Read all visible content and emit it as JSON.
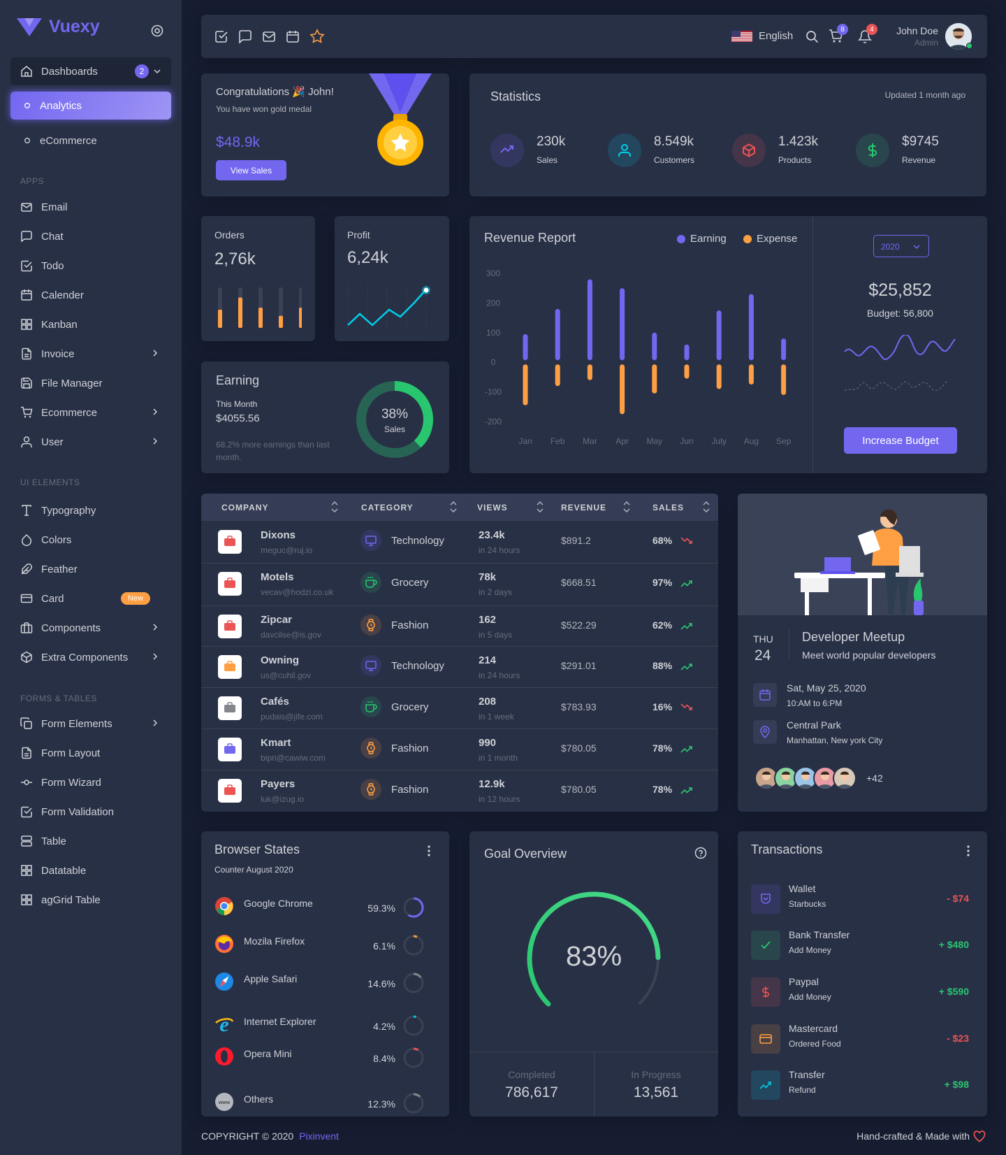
{
  "brand": {
    "name": "Vuexy"
  },
  "sidebar": {
    "dashboards": "Dashboards",
    "dashboards_badge": "2",
    "analytics": "Analytics",
    "ecommerce_dash": "eCommerce",
    "apps_head": "APPS",
    "apps": [
      "Email",
      "Chat",
      "Todo",
      "Calender",
      "Kanban",
      "Invoice",
      "File Manager",
      "Ecommerce",
      "User"
    ],
    "ui_head": "UI ELEMENTS",
    "ui": [
      "Typography",
      "Colors",
      "Feather",
      "Card",
      "Components",
      "Extra Components"
    ],
    "card_badge": "New",
    "forms_head": "FORMS & TABLES",
    "forms": [
      "Form Elements",
      "Form Layout",
      "Form Wizard",
      "Form Validation",
      "Table",
      "Datatable",
      "agGrid Table"
    ]
  },
  "navbar": {
    "language": "English",
    "cart_count": "8",
    "notif_count": "4",
    "user_name": "John Doe",
    "user_role": "Admin"
  },
  "congrats": {
    "title": "Congratulations 🎉 John!",
    "subtitle": "You have won gold medal",
    "amount": "$48.9k",
    "button": "View Sales"
  },
  "statistics": {
    "title": "Statistics",
    "updated": "Updated 1 month ago",
    "items": [
      {
        "value": "230k",
        "label": "Sales",
        "icon": "trending-up-icon",
        "color": "#7367f0"
      },
      {
        "value": "8.549k",
        "label": "Customers",
        "icon": "user-icon",
        "color": "#00cfe8"
      },
      {
        "value": "1.423k",
        "label": "Products",
        "icon": "box-icon",
        "color": "#ea5455"
      },
      {
        "value": "$9745",
        "label": "Revenue",
        "icon": "dollar-icon",
        "color": "#28c76f"
      }
    ]
  },
  "orders": {
    "label": "Orders",
    "value": "2,76k",
    "bars": [
      0.45,
      0.75,
      0.5,
      0.3,
      0.5
    ]
  },
  "profit": {
    "label": "Profit",
    "value": "6,24k"
  },
  "earning": {
    "title": "Earning",
    "period": "This Month",
    "amount": "$4055.56",
    "note": "68.2% more earnings than last month.",
    "percent": "38%",
    "percent_label": "Sales",
    "fraction": 0.38
  },
  "revenue": {
    "title": "Revenue Report",
    "legend_earning": "Earning",
    "legend_expense": "Expense",
    "year": "2020",
    "budget_value": "$25,852",
    "budget_label": "Budget: 56,800",
    "button": "Increase Budget"
  },
  "chart_data": {
    "type": "bar",
    "categories": [
      "Jan",
      "Feb",
      "Mar",
      "Apr",
      "May",
      "Jun",
      "July",
      "Aug",
      "Sep"
    ],
    "series": [
      {
        "name": "Earning",
        "values": [
          95,
          180,
          280,
          250,
          100,
          60,
          175,
          230,
          80
        ]
      },
      {
        "name": "Expense",
        "values": [
          -145,
          -80,
          -60,
          -175,
          -105,
          -55,
          -90,
          -75,
          -110
        ]
      }
    ],
    "ylim": [
      -200,
      300
    ],
    "yticks": [
      "300",
      "200",
      "100",
      "0",
      "-100",
      "-200"
    ],
    "colors": {
      "earning": "#7367f0",
      "expense": "#ff9f43"
    }
  },
  "table": {
    "headers": [
      "COMPANY",
      "CATEGORY",
      "VIEWS",
      "REVENUE",
      "SALES"
    ],
    "rows": [
      {
        "company": "Dixons",
        "email": "meguc@ruj.io",
        "category": "Technology",
        "views": "23.4k",
        "views_time": "in 24 hours",
        "revenue": "$891.2",
        "sales": "68%",
        "trend": "down"
      },
      {
        "company": "Motels",
        "email": "vecav@hodzi.co.uk",
        "category": "Grocery",
        "views": "78k",
        "views_time": "in 2 days",
        "revenue": "$668.51",
        "sales": "97%",
        "trend": "up"
      },
      {
        "company": "Zipcar",
        "email": "davcilse@is.gov",
        "category": "Fashion",
        "views": "162",
        "views_time": "in 5 days",
        "revenue": "$522.29",
        "sales": "62%",
        "trend": "up"
      },
      {
        "company": "Owning",
        "email": "us@cuhil.gov",
        "category": "Technology",
        "views": "214",
        "views_time": "in 24 hours",
        "revenue": "$291.01",
        "sales": "88%",
        "trend": "up"
      },
      {
        "company": "Cafés",
        "email": "pudais@jife.com",
        "category": "Grocery",
        "views": "208",
        "views_time": "in 1 week",
        "revenue": "$783.93",
        "sales": "16%",
        "trend": "down"
      },
      {
        "company": "Kmart",
        "email": "bipri@cawiw.com",
        "category": "Fashion",
        "views": "990",
        "views_time": "in 1 month",
        "revenue": "$780.05",
        "sales": "78%",
        "trend": "up"
      },
      {
        "company": "Payers",
        "email": "luk@izug.io",
        "category": "Fashion",
        "views": "12.9k",
        "views_time": "in 12 hours",
        "revenue": "$780.05",
        "sales": "78%",
        "trend": "up"
      }
    ]
  },
  "meetup": {
    "day": "THU",
    "date": "24",
    "title": "Developer Meetup",
    "subtitle": "Meet world popular developers",
    "when": "Sat, May 25, 2020",
    "when_sub": "10:AM to 6:PM",
    "where": "Central Park",
    "where_sub": "Manhattan, New york City",
    "more": "+42"
  },
  "browser": {
    "title": "Browser States",
    "subtitle": "Counter August 2020",
    "items": [
      {
        "name": "Google Chrome",
        "pct": "59.3%",
        "value": 0.593,
        "color": "#7367f0"
      },
      {
        "name": "Mozila Firefox",
        "pct": "6.1%",
        "value": 0.061,
        "color": "#ff9f43"
      },
      {
        "name": "Apple Safari",
        "pct": "14.6%",
        "value": 0.146,
        "color": "#82868b"
      },
      {
        "name": "Internet Explorer",
        "pct": "4.2%",
        "value": 0.042,
        "color": "#00cfe8"
      },
      {
        "name": "Opera Mini",
        "pct": "8.4%",
        "value": 0.084,
        "color": "#ea5455"
      },
      {
        "name": "Others",
        "pct": "12.3%",
        "value": 0.123,
        "color": "#82868b"
      }
    ]
  },
  "goal": {
    "title": "Goal Overview",
    "percent": "83%",
    "value": 0.83,
    "completed_label": "Completed",
    "completed": "786,617",
    "progress_label": "In Progress",
    "progress": "13,561"
  },
  "transactions": {
    "title": "Transactions",
    "items": [
      {
        "name": "Wallet",
        "sub": "Starbucks",
        "amount": "- $74",
        "color": "#7367f0",
        "positive": false
      },
      {
        "name": "Bank Transfer",
        "sub": "Add Money",
        "amount": "+ $480",
        "color": "#28c76f",
        "positive": true
      },
      {
        "name": "Paypal",
        "sub": "Add Money",
        "amount": "+ $590",
        "color": "#ea5455",
        "positive": true
      },
      {
        "name": "Mastercard",
        "sub": "Ordered Food",
        "amount": "- $23",
        "color": "#ff9f43",
        "positive": false
      },
      {
        "name": "Transfer",
        "sub": "Refund",
        "amount": "+ $98",
        "color": "#00cfe8",
        "positive": true
      }
    ]
  },
  "footer": {
    "copyright": "COPYRIGHT © 2020",
    "company": "Pixinvent",
    "right": "Hand-crafted & Made with"
  }
}
